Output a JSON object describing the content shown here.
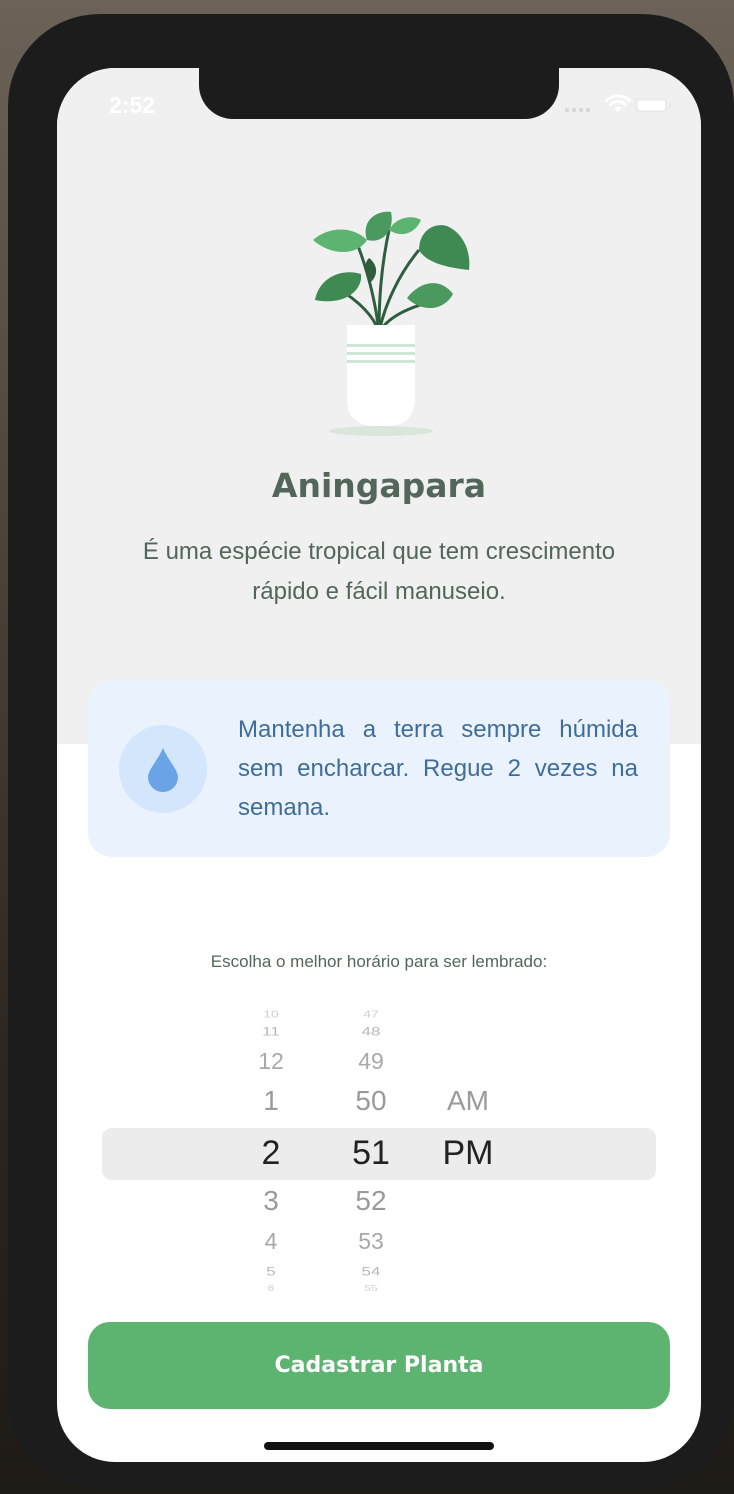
{
  "status_bar": {
    "time": "2:52"
  },
  "plant": {
    "name": "Aningapara",
    "about": "É uma espécie tropical que tem crescimento rápido e fácil manuseio."
  },
  "water_tip": {
    "text": "Mantenha a terra sempre húmida sem encharcar. Regue 2 vezes na semana.",
    "icon": "water-drop-icon",
    "colors": {
      "card": "#eaf3fd",
      "circle": "#d4e6fb",
      "drop": "#6aa4e6",
      "text": "#3f6d99"
    }
  },
  "reminder": {
    "label": "Escolha o melhor horário para ser lembrado:",
    "hours": [
      "10",
      "11",
      "12",
      "1",
      "2",
      "3",
      "4",
      "5",
      "6"
    ],
    "minutes": [
      "47",
      "48",
      "49",
      "50",
      "51",
      "52",
      "53",
      "54",
      "55"
    ],
    "periods": [
      "AM",
      "PM"
    ],
    "selected": {
      "hour": "2",
      "minute": "51",
      "period": "PM"
    }
  },
  "cta": {
    "label": "Cadastrar Planta",
    "color": "#5db471"
  }
}
